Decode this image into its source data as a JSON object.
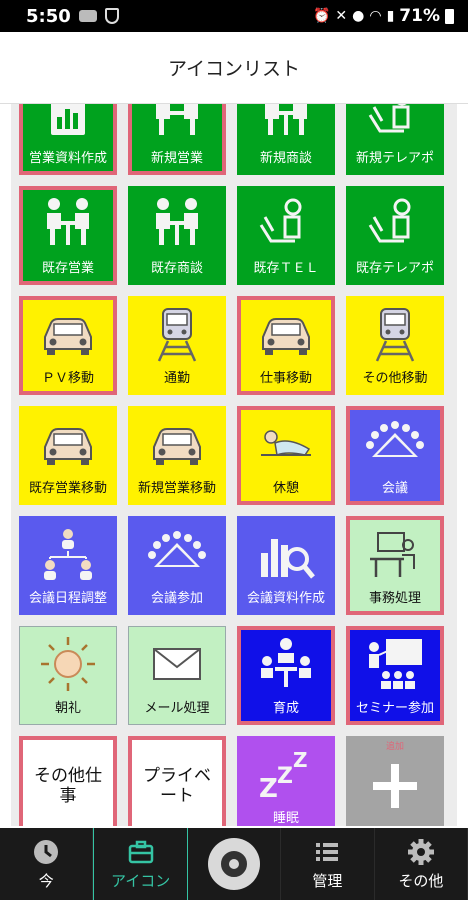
{
  "status": {
    "time": "5:50",
    "battery_pct": "71%"
  },
  "header": {
    "title": "アイコンリスト"
  },
  "tiles": [
    {
      "label": "営業資料作成",
      "color": "green",
      "icon": "document-chart-icon",
      "red": true
    },
    {
      "label": "新規営業",
      "color": "green",
      "icon": "handshake-icon",
      "red": true
    },
    {
      "label": "新規商談",
      "color": "green",
      "icon": "meeting-icon",
      "red": false
    },
    {
      "label": "新規テレアポ",
      "color": "green",
      "icon": "telephone-operator-icon",
      "red": false
    },
    {
      "label": "既存営業",
      "color": "green",
      "icon": "meeting-icon",
      "red": true
    },
    {
      "label": "既存商談",
      "color": "green",
      "icon": "meeting-icon",
      "red": false
    },
    {
      "label": "既存ＴＥＬ",
      "color": "green",
      "icon": "telephone-operator-icon",
      "red": false
    },
    {
      "label": "既存テレアポ",
      "color": "green",
      "icon": "telephone-operator-icon",
      "red": false
    },
    {
      "label": "ＰＶ移動",
      "color": "yellow",
      "icon": "car-icon",
      "red": true
    },
    {
      "label": "通勤",
      "color": "yellow",
      "icon": "train-icon",
      "red": false
    },
    {
      "label": "仕事移動",
      "color": "yellow",
      "icon": "car-icon",
      "red": true
    },
    {
      "label": "その他移動",
      "color": "yellow",
      "icon": "train-icon",
      "red": false
    },
    {
      "label": "既存営業移動",
      "color": "yellow",
      "icon": "car-icon",
      "red": false
    },
    {
      "label": "新規営業移動",
      "color": "yellow",
      "icon": "car-icon",
      "red": false
    },
    {
      "label": "休憩",
      "color": "yellow",
      "icon": "resting-person-icon",
      "red": true
    },
    {
      "label": "会議",
      "color": "blue",
      "icon": "conference-table-icon",
      "red": true
    },
    {
      "label": "会議日程調整",
      "color": "blue",
      "icon": "team-network-icon",
      "red": false
    },
    {
      "label": "会議参加",
      "color": "blue",
      "icon": "conference-table-icon",
      "red": false
    },
    {
      "label": "会議資料作成",
      "color": "blue",
      "icon": "bar-chart-magnifier-icon",
      "red": false
    },
    {
      "label": "事務処理",
      "color": "mint",
      "icon": "desk-worker-icon",
      "red": true
    },
    {
      "label": "朝礼",
      "color": "mint",
      "icon": "sun-icon",
      "red": false
    },
    {
      "label": "メール処理",
      "color": "mint",
      "icon": "envelope-icon",
      "red": false
    },
    {
      "label": "育成",
      "color": "darkblue",
      "icon": "mentoring-icon",
      "red": true
    },
    {
      "label": "セミナー参加",
      "color": "darkblue",
      "icon": "seminar-presentation-icon",
      "red": true
    }
  ],
  "last_row": {
    "other_work": "その他仕事",
    "private": "プライベート",
    "sleep": "睡眠",
    "add_hint": "追加"
  },
  "nav": [
    {
      "label": "今",
      "icon": "clock-icon"
    },
    {
      "label": "アイコン",
      "icon": "briefcase-icon"
    },
    {
      "label": "",
      "icon": "disc-icon"
    },
    {
      "label": "管理",
      "icon": "list-icon"
    },
    {
      "label": "その他",
      "icon": "gear-icon"
    }
  ],
  "colors": {
    "green": "#00a21e",
    "yellow": "#fff200",
    "blue": "#5a5aee",
    "darkblue": "#1010e8",
    "mint": "#c2f0c2",
    "purple": "#b050ee",
    "highlight": "#e06678",
    "nav_active": "#35c4a4"
  }
}
